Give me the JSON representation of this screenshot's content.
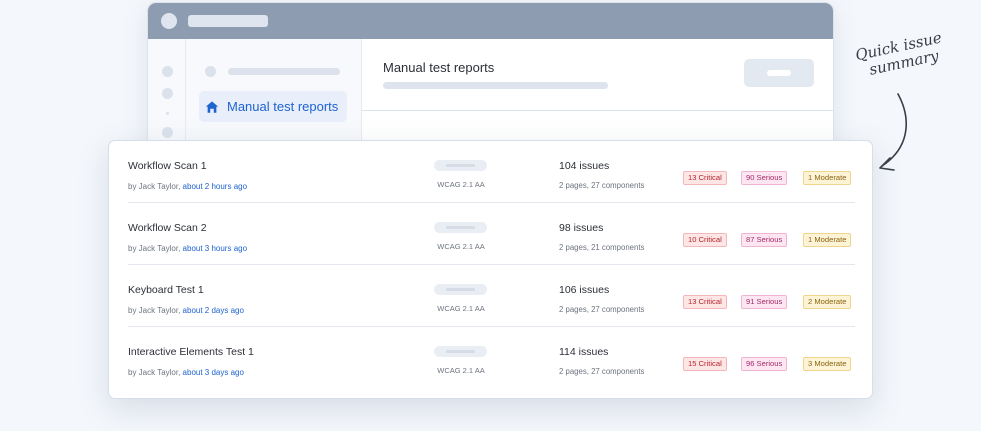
{
  "window": {
    "content_title": "Manual test reports"
  },
  "sidebar": {
    "active_item": {
      "label": "Manual test reports",
      "icon": "home-icon"
    }
  },
  "annotation": {
    "line1": "Quick issue",
    "line2": "summary"
  },
  "reports": [
    {
      "name": "Workflow Scan 1",
      "by_prefix": "by Jack Taylor, ",
      "time": "about 2 hours ago",
      "standard": "WCAG 2.1 AA",
      "issues": "104 issues",
      "pages": "2 pages, 27 components",
      "critical": "13 Critical",
      "serious": "90 Serious",
      "moderate": "1 Moderate"
    },
    {
      "name": "Workflow Scan 2",
      "by_prefix": "by Jack Taylor, ",
      "time": "about 3 hours ago",
      "standard": "WCAG 2.1 AA",
      "issues": "98 issues",
      "pages": "2 pages, 21 components",
      "critical": "10 Critical",
      "serious": "87 Serious",
      "moderate": "1 Moderate"
    },
    {
      "name": "Keyboard Test 1",
      "by_prefix": "by Jack Taylor, ",
      "time": "about 2 days ago",
      "standard": "WCAG 2.1 AA",
      "issues": "106 issues",
      "pages": "2 pages, 27 components",
      "critical": "13 Critical",
      "serious": "91 Serious",
      "moderate": "2 Moderate"
    },
    {
      "name": "Interactive Elements Test 1",
      "by_prefix": "by Jack Taylor, ",
      "time": "about 3 days ago",
      "standard": "WCAG 2.1 AA",
      "issues": "114 issues",
      "pages": "2 pages, 27 components",
      "critical": "15 Critical",
      "serious": "96 Serious",
      "moderate": "3 Moderate"
    }
  ],
  "colors": {
    "accent": "#1e63d0",
    "critical": "#b3262d",
    "serious": "#a52a6c",
    "moderate": "#8a6410"
  }
}
